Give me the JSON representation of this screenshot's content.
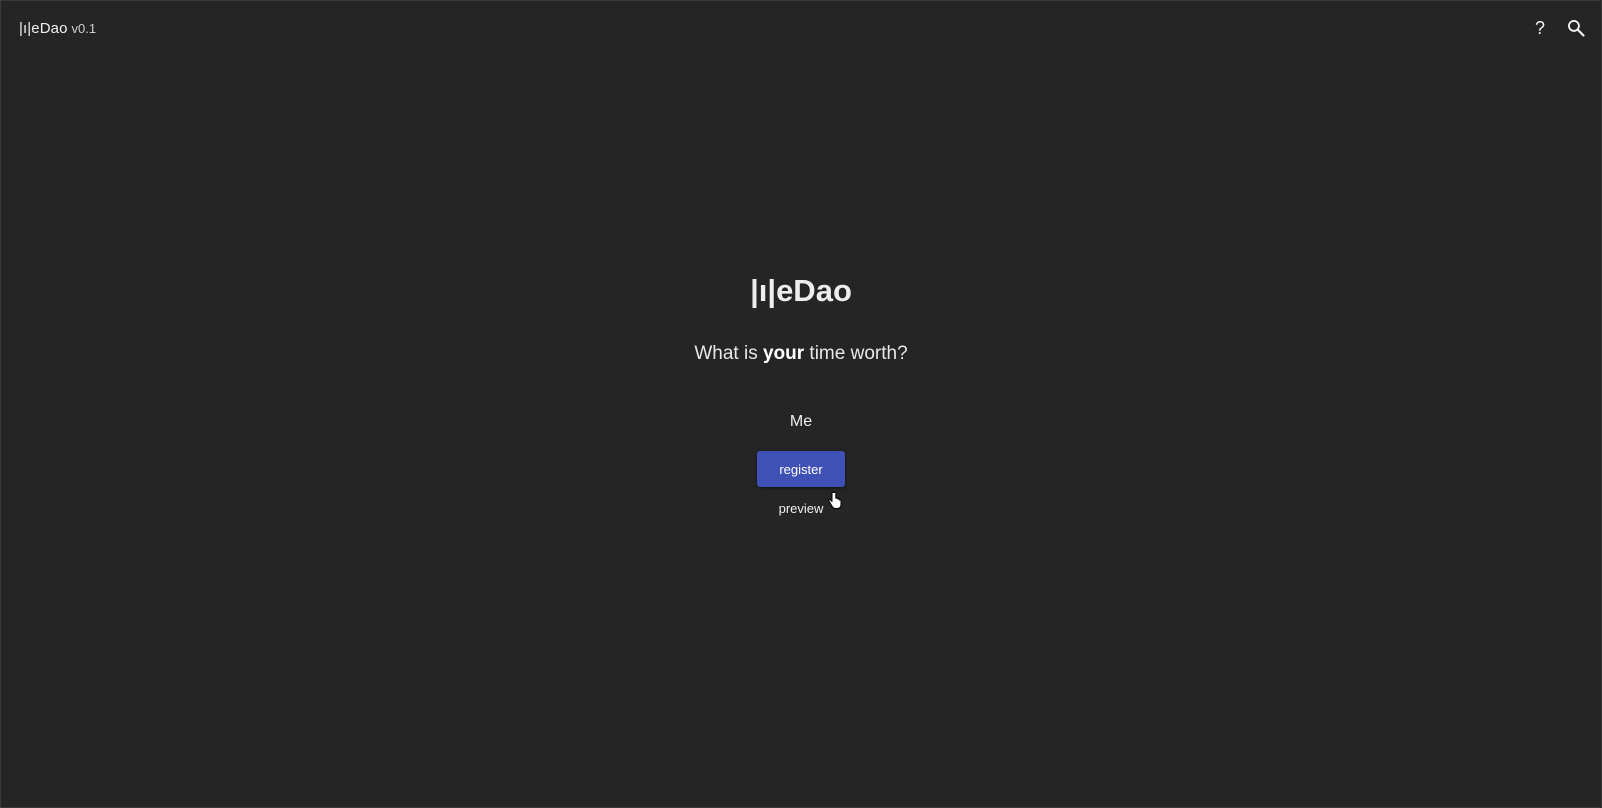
{
  "header": {
    "brand_name": "|ı|eDao",
    "version": "v0.1",
    "help_label": "?",
    "search_icon": "search-icon"
  },
  "main": {
    "logo_text": "|ı|eDao",
    "headline": {
      "prefix": "What is ",
      "emphasis": "your",
      "suffix": " time worth?"
    },
    "name_input_value": "Me",
    "register_label": "register",
    "preview_label": "preview"
  },
  "colors": {
    "background": "#252525",
    "accent": "#3f51b5"
  }
}
